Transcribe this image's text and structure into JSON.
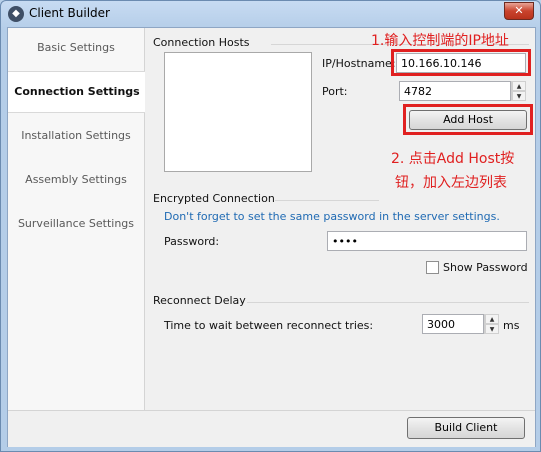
{
  "window": {
    "title": "Client Builder",
    "close_glyph": "✕",
    "app_icon_glyph": "◆"
  },
  "sidebar": {
    "items": [
      {
        "label": "Basic Settings"
      },
      {
        "label": "Connection Settings",
        "active": true
      },
      {
        "label": "Installation Settings"
      },
      {
        "label": "Assembly Settings"
      },
      {
        "label": "Surveillance Settings"
      }
    ]
  },
  "connection_hosts": {
    "section_label": "Connection Hosts",
    "ip_label": "IP/Hostname:",
    "ip_value": "10.166.10.146",
    "port_label": "Port:",
    "port_value": "4782",
    "add_host_label": "Add Host"
  },
  "annotations": {
    "note1": "1.输入控制端的IP地址",
    "note2_line1": "2. 点击Add Host按",
    "note2_line2": "钮，加入左边列表",
    "color": "#e02020"
  },
  "encrypted": {
    "section_label": "Encrypted Connection",
    "hint": "Don't forget to set the same password in the server settings.",
    "password_label": "Password:",
    "password_value": "••••",
    "show_password_label": "Show Password",
    "show_password_checked": false
  },
  "reconnect": {
    "section_label": "Reconnect Delay",
    "wait_label": "Time to wait between reconnect tries:",
    "wait_value": "3000",
    "unit": "ms"
  },
  "footer": {
    "build_label": "Build Client"
  },
  "spinner": {
    "up_glyph": "▲",
    "down_glyph": "▼"
  }
}
